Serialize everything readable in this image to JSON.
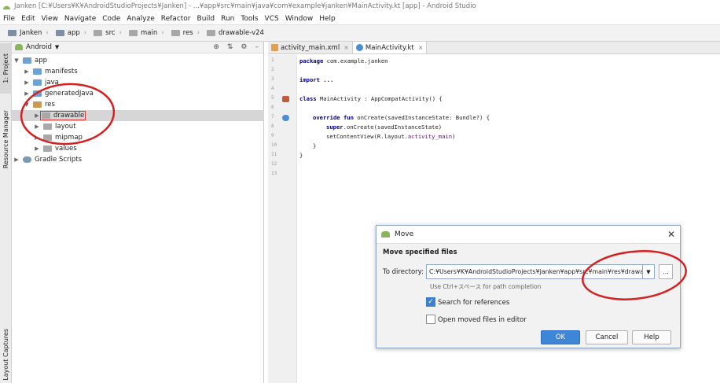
{
  "titlebar": {
    "title": "Janken [C:¥Users¥K¥AndroidStudioProjects¥Janken] - ...¥app¥src¥main¥java¥com¥example¥janken¥MainActivity.kt [app] - Android Studio"
  },
  "menu": [
    "File",
    "Edit",
    "View",
    "Navigate",
    "Code",
    "Analyze",
    "Refactor",
    "Build",
    "Run",
    "Tools",
    "VCS",
    "Window",
    "Help"
  ],
  "breadcrumb": [
    "Janken",
    "app",
    "src",
    "main",
    "res",
    "drawable-v24"
  ],
  "left_strip": {
    "project_tab": "1: Project",
    "resource_manager_tab": "Resource Manager",
    "layout_captures_tab": "Layout Captures"
  },
  "project": {
    "view_selector": "Android",
    "tree": [
      {
        "label": "app",
        "depth": 0,
        "expanded": true
      },
      {
        "label": "manifests",
        "depth": 1,
        "expanded": false
      },
      {
        "label": "java",
        "depth": 1,
        "expanded": false
      },
      {
        "label": "generatedJava",
        "depth": 1,
        "expanded": false
      },
      {
        "label": "res",
        "depth": 1,
        "expanded": true
      },
      {
        "label": "drawable",
        "depth": 2,
        "expanded": false,
        "selected": true
      },
      {
        "label": "layout",
        "depth": 2,
        "expanded": false
      },
      {
        "label": "mipmap",
        "depth": 2,
        "expanded": false
      },
      {
        "label": "values",
        "depth": 2,
        "expanded": false
      },
      {
        "label": "Gradle Scripts",
        "depth": 0,
        "expanded": false
      }
    ]
  },
  "editor": {
    "tabs": [
      {
        "label": "activity_main.xml",
        "active": false
      },
      {
        "label": "MainActivity.kt",
        "active": true
      }
    ],
    "line_numbers": [
      "1",
      "2",
      "3",
      "4",
      "5",
      "6",
      "7",
      "8",
      "9",
      "10",
      "11",
      "12",
      "13"
    ],
    "code": {
      "package_kw": "package",
      "package_name": " com.example.janken",
      "import_kw": "import",
      "import_rest": " ...",
      "class_kw": "class",
      "class_rest": " MainActivity : AppCompatActivity() {",
      "override_kw": "override fun",
      "override_rest": " onCreate(savedInstanceState: Bundle?) {",
      "super_kw": "super",
      "super_rest": ".onCreate(savedInstanceState)",
      "setcontent_pre": "setContentView(R.layout.",
      "setcontent_member": "activity_main",
      "setcontent_post": ")",
      "close_inner": "}",
      "close_outer": "}"
    }
  },
  "dialog": {
    "title": "Move",
    "header": "Move specified files",
    "to_directory_label": "To directory:",
    "to_directory_value": "C:¥Users¥K¥AndroidStudioProjects¥Janken¥app¥src¥main¥res¥drawable",
    "browse_label": "...",
    "hint": "Use Ctrl+スペース for path completion",
    "search_references_label": "Search for references",
    "search_references_checked": true,
    "open_moved_label": "Open moved files in editor",
    "open_moved_checked": false,
    "ok_label": "OK",
    "cancel_label": "Cancel",
    "help_label": "Help"
  },
  "colors": {
    "accent": "#3e87d8",
    "annotation": "#d42020",
    "folder_blue": "#6ea1d4",
    "android_green": "#8bb35a"
  }
}
